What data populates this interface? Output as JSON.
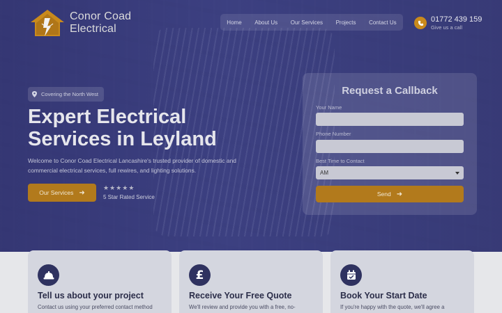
{
  "brand": {
    "name_line1": "Conor Coad",
    "name_line2": "Electrical"
  },
  "nav": {
    "items": [
      "Home",
      "About Us",
      "Our Services",
      "Projects",
      "Contact Us"
    ]
  },
  "phone": {
    "number": "01772 439 159",
    "sub": "Give us a call"
  },
  "hero": {
    "badge": "Covering the North West",
    "title_line1": "Expert Electrical",
    "title_line2": "Services in Leyland",
    "description": "Welcome to Conor Coad Electrical Lancashire's trusted provider of domestic and commercial electrical services, full rewires, and lighting solutions.",
    "cta_label": "Our Services",
    "rating_stars": 5,
    "rating_text": "5 Star Rated Service"
  },
  "callback_form": {
    "title": "Request a Callback",
    "name_label": "Your Name",
    "phone_label": "Phone Number",
    "time_label": "Best Time to Contact",
    "time_value": "AM",
    "send_label": "Send"
  },
  "steps": [
    {
      "icon": "hardhat-icon",
      "title": "Tell us about your project",
      "text": "Contact us using your preferred contact method"
    },
    {
      "icon": "pound-icon",
      "title": "Receive Your Free Quote",
      "text": "We'll review and provide you with a free, no-"
    },
    {
      "icon": "calendar-check-icon",
      "title": "Book Your Start Date",
      "text": "If you're happy with the quote, we'll agree a"
    }
  ],
  "colors": {
    "accent": "#b27a1c",
    "hero_overlay": "#3b3e7a",
    "icon_circle": "#2f3260"
  }
}
